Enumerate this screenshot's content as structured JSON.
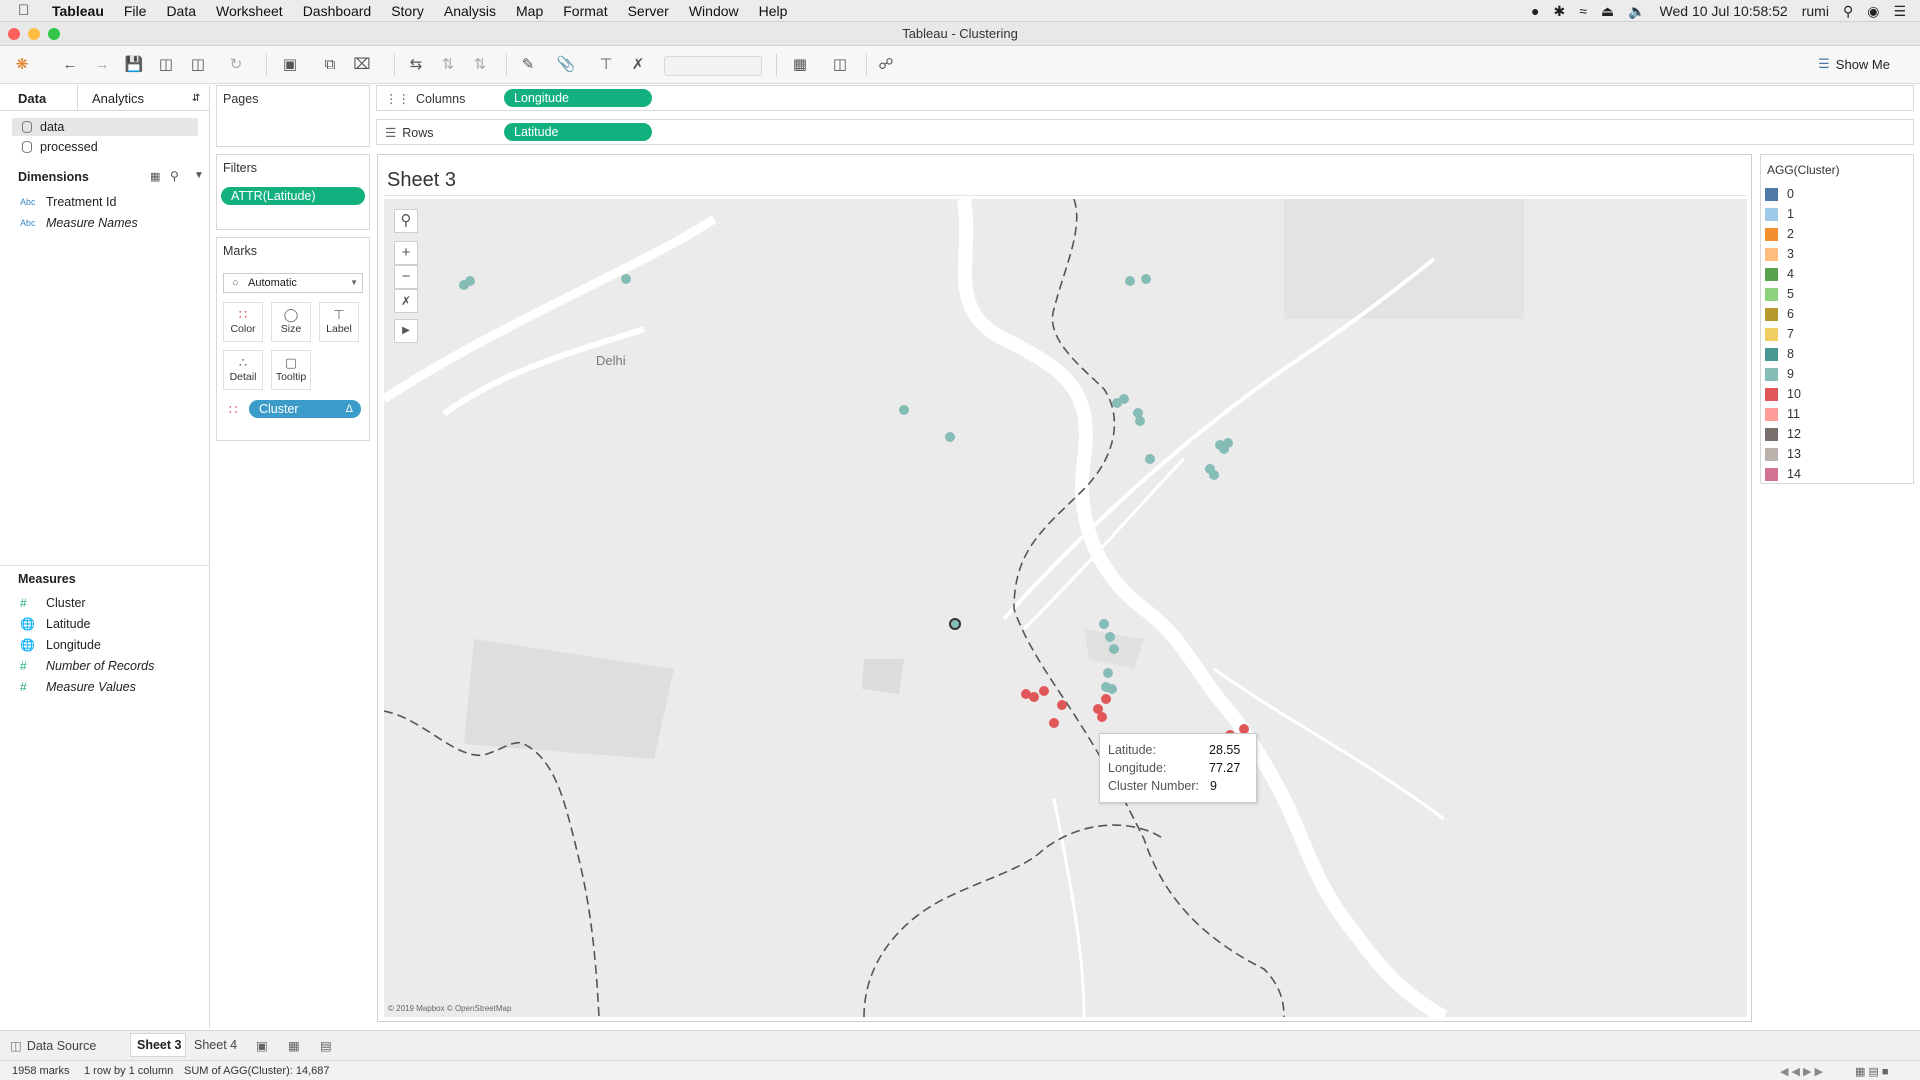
{
  "menubar": {
    "app": "Tableau",
    "items": [
      "File",
      "Data",
      "Worksheet",
      "Dashboard",
      "Story",
      "Analysis",
      "Map",
      "Format",
      "Server",
      "Window",
      "Help"
    ],
    "clock": "Wed 10 Jul  10:58:52",
    "user": "rumi"
  },
  "window": {
    "title": "Tableau - Clustering"
  },
  "toolbar": {
    "show_me": "Show Me"
  },
  "datapane": {
    "tabs": [
      "Data",
      "Analytics"
    ],
    "datasources": [
      "data",
      "processed"
    ],
    "dimensions_title": "Dimensions",
    "dimensions": [
      {
        "type": "Abc",
        "name": "Treatment Id"
      },
      {
        "type": "Abc",
        "name": "Measure Names"
      }
    ],
    "measures_title": "Measures",
    "measures": [
      {
        "icon": "#",
        "name": "Cluster"
      },
      {
        "icon": "globe",
        "name": "Latitude"
      },
      {
        "icon": "globe",
        "name": "Longitude"
      },
      {
        "icon": "#",
        "name": "Number of Records"
      },
      {
        "icon": "#",
        "name": "Measure Values"
      }
    ]
  },
  "pages": {
    "title": "Pages"
  },
  "filters": {
    "title": "Filters",
    "pill": "ATTR(Latitude)"
  },
  "marks": {
    "title": "Marks",
    "type": "Automatic",
    "buttons": [
      "Color",
      "Size",
      "Label",
      "Detail",
      "Tooltip"
    ],
    "cluster_pill": "Cluster"
  },
  "shelves": {
    "columns_label": "Columns",
    "columns_pill": "Longitude",
    "rows_label": "Rows",
    "rows_pill": "Latitude"
  },
  "sheet": {
    "title": "Sheet 3"
  },
  "map": {
    "city_label": "Delhi",
    "attribution": "© 2019 Mapbox © OpenStreetMap"
  },
  "tooltip": {
    "lat_label": "Latitude:",
    "lat_value": "28.55",
    "lon_label": "Longitude:",
    "lon_value": "77.27",
    "cluster_label": "Cluster Number:",
    "cluster_value": "9"
  },
  "legend": {
    "title": "AGG(Cluster)",
    "items": [
      {
        "label": "0",
        "color": "#4e79a7"
      },
      {
        "label": "1",
        "color": "#a0cbe8"
      },
      {
        "label": "2",
        "color": "#f28e2b"
      },
      {
        "label": "3",
        "color": "#ffbe7d"
      },
      {
        "label": "4",
        "color": "#59a14f"
      },
      {
        "label": "5",
        "color": "#8cd17d"
      },
      {
        "label": "6",
        "color": "#b6992d"
      },
      {
        "label": "7",
        "color": "#f1ce63"
      },
      {
        "label": "8",
        "color": "#499894"
      },
      {
        "label": "9",
        "color": "#86bcb6"
      },
      {
        "label": "10",
        "color": "#e15759"
      },
      {
        "label": "11",
        "color": "#ff9d9a"
      },
      {
        "label": "12",
        "color": "#79706e"
      },
      {
        "label": "13",
        "color": "#bab0ac"
      },
      {
        "label": "14",
        "color": "#d37295"
      }
    ]
  },
  "sheettabs": {
    "datasource": "Data Source",
    "tabs": [
      "Sheet 3",
      "Sheet 4"
    ]
  },
  "status": {
    "marks": "1958 marks",
    "rows_cols": "1 row by 1 column",
    "sum": "SUM of AGG(Cluster): 14,687"
  }
}
